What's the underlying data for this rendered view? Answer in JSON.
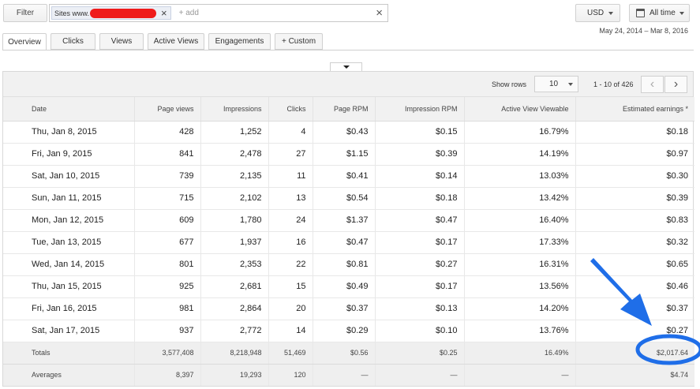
{
  "filter": {
    "button_label": "Filter",
    "chip_label": "Sites www.",
    "add_placeholder": "+ add"
  },
  "currency": {
    "label": "USD"
  },
  "time_range": {
    "label": "All time",
    "range_text": "May 24, 2014 – Mar 8, 2016"
  },
  "tabs": [
    {
      "label": "Overview",
      "active": true
    },
    {
      "label": "Clicks"
    },
    {
      "label": "Views"
    },
    {
      "label": "Active Views"
    },
    {
      "label": "Engagements"
    },
    {
      "label": "+ Custom"
    }
  ],
  "pager": {
    "show_rows_label": "Show rows",
    "rows_value": "10",
    "page_info": "1 - 10 of 426"
  },
  "table": {
    "columns": [
      "Date",
      "Page views",
      "Impressions",
      "Clicks",
      "Page RPM",
      "Impression RPM",
      "Active View Viewable",
      "Estimated earnings *"
    ],
    "rows": [
      [
        "Thu, Jan 8, 2015",
        "428",
        "1,252",
        "4",
        "$0.43",
        "$0.15",
        "16.79%",
        "$0.18"
      ],
      [
        "Fri, Jan 9, 2015",
        "841",
        "2,478",
        "27",
        "$1.15",
        "$0.39",
        "14.19%",
        "$0.97"
      ],
      [
        "Sat, Jan 10, 2015",
        "739",
        "2,135",
        "11",
        "$0.41",
        "$0.14",
        "13.03%",
        "$0.30"
      ],
      [
        "Sun, Jan 11, 2015",
        "715",
        "2,102",
        "13",
        "$0.54",
        "$0.18",
        "13.42%",
        "$0.39"
      ],
      [
        "Mon, Jan 12, 2015",
        "609",
        "1,780",
        "24",
        "$1.37",
        "$0.47",
        "16.40%",
        "$0.83"
      ],
      [
        "Tue, Jan 13, 2015",
        "677",
        "1,937",
        "16",
        "$0.47",
        "$0.17",
        "17.33%",
        "$0.32"
      ],
      [
        "Wed, Jan 14, 2015",
        "801",
        "2,353",
        "22",
        "$0.81",
        "$0.27",
        "16.31%",
        "$0.65"
      ],
      [
        "Thu, Jan 15, 2015",
        "925",
        "2,681",
        "15",
        "$0.49",
        "$0.17",
        "13.56%",
        "$0.46"
      ],
      [
        "Fri, Jan 16, 2015",
        "981",
        "2,864",
        "20",
        "$0.37",
        "$0.13",
        "14.20%",
        "$0.37"
      ],
      [
        "Sat, Jan 17, 2015",
        "937",
        "2,772",
        "14",
        "$0.29",
        "$0.10",
        "13.76%",
        "$0.27"
      ]
    ],
    "totals": [
      "Totals",
      "3,577,408",
      "8,218,948",
      "51,469",
      "$0.56",
      "$0.25",
      "16.49%",
      "$2,017.64"
    ],
    "averages": [
      "Averages",
      "8,397",
      "19,293",
      "120",
      "—",
      "—",
      "—",
      "$4.74"
    ]
  },
  "colors": {
    "annotation": "#1f6ee8",
    "redaction": "#ef1b1b"
  }
}
